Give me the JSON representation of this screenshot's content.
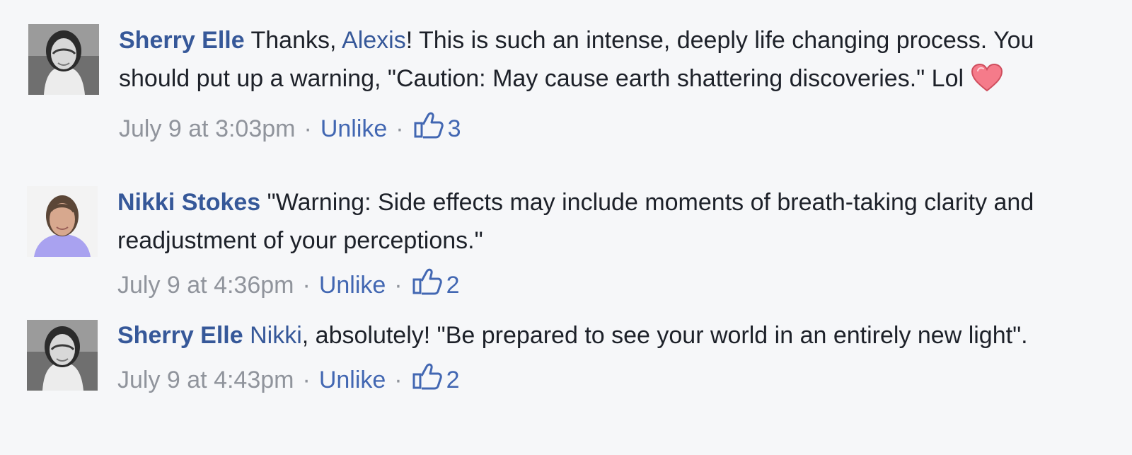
{
  "comments": [
    {
      "author": "Sherry Elle",
      "before_mention": " Thanks, ",
      "mention": "Alexis",
      "after_mention": "! This is such an intense, deeply life changing process. You should put up a warning, \"Caution: May cause earth shattering discoveries.\" Lol",
      "emoji": "heart-icon",
      "timestamp": "July 9 at 3:03pm",
      "separator": "·",
      "action": "Unlike",
      "likes": "3"
    },
    {
      "author": "Nikki Stokes",
      "before_mention": "",
      "mention": "",
      "after_mention": " \"Warning: Side effects may include moments of breath-taking clarity and readjustment of your perceptions.\"",
      "timestamp": "July 9 at 4:36pm",
      "separator": "·",
      "action": "Unlike",
      "likes": "2"
    },
    {
      "author": "Sherry Elle",
      "before_mention": " ",
      "mention": "Nikki",
      "after_mention": ", absolutely! \"Be prepared to see your world in an entirely new light\".",
      "timestamp": "July 9 at 4:43pm",
      "separator": "·",
      "action": "Unlike",
      "likes": "2"
    }
  ],
  "colors": {
    "background": "#f6f7f9",
    "author": "#365899",
    "link": "#4267b2",
    "meta": "#90949c",
    "text": "#1d2129",
    "heart": "#f25268"
  }
}
